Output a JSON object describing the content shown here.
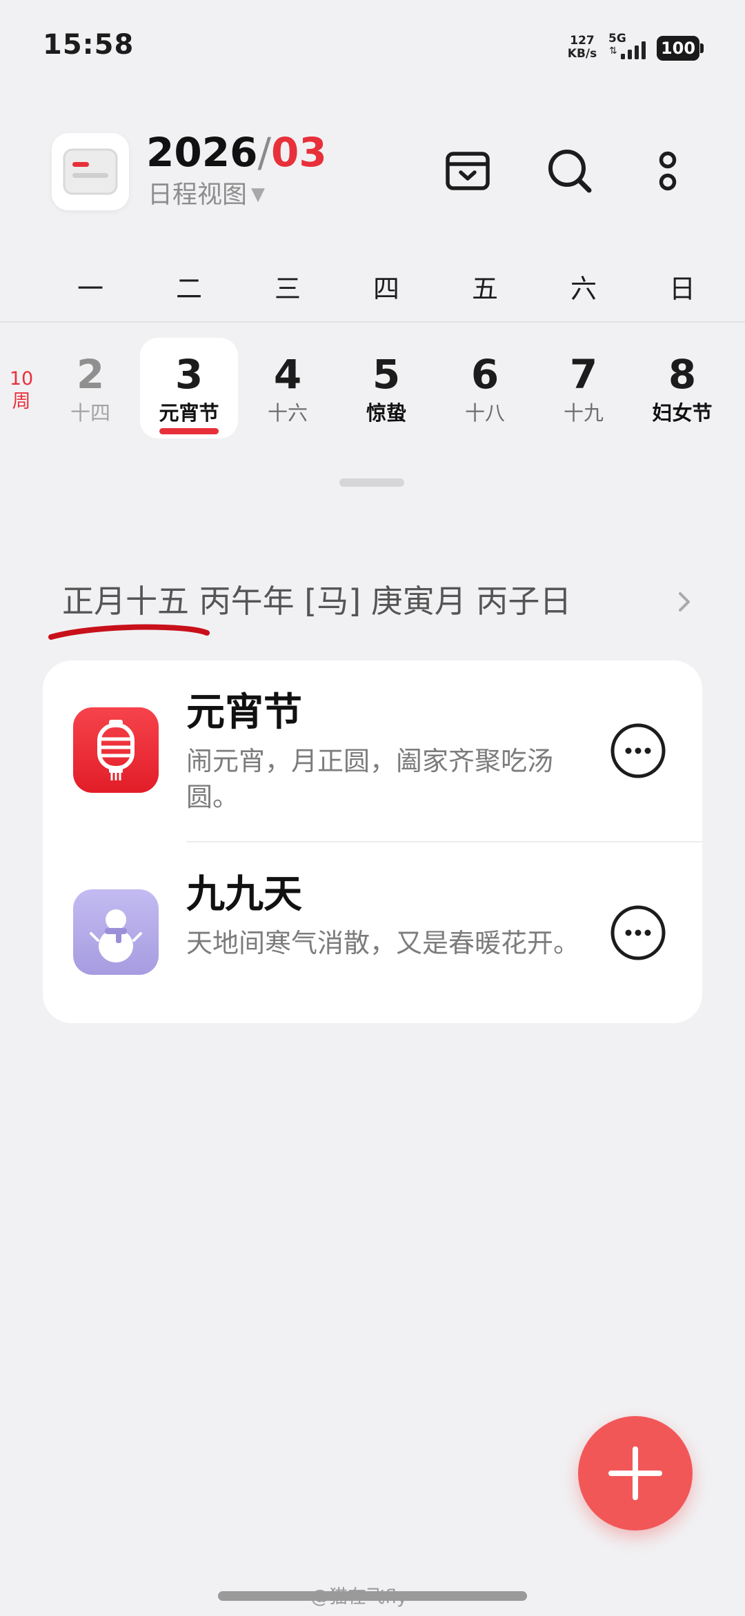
{
  "status_bar": {
    "time": "15:58",
    "net_speed_value": "127",
    "net_speed_unit": "KB/s",
    "network_type": "5G",
    "battery": "100"
  },
  "header": {
    "year": "2026",
    "separator": "/",
    "month": "03",
    "view_mode": "日程视图"
  },
  "weekdays": [
    "一",
    "二",
    "三",
    "四",
    "五",
    "六",
    "日"
  ],
  "week": {
    "number": "10",
    "unit": "周",
    "days": [
      {
        "num": "2",
        "sub": "十四"
      },
      {
        "num": "3",
        "sub": "元宵节"
      },
      {
        "num": "4",
        "sub": "十六"
      },
      {
        "num": "5",
        "sub": "惊蛰"
      },
      {
        "num": "6",
        "sub": "十八"
      },
      {
        "num": "7",
        "sub": "十九"
      },
      {
        "num": "8",
        "sub": "妇女节"
      }
    ]
  },
  "lunar": {
    "lunar_date": "正月十五",
    "ganzhi": "丙午年 [马] 庚寅月 丙子日"
  },
  "events": [
    {
      "title": "元宵节",
      "description": "闹元宵，月正圆，阖家齐聚吃汤圆。",
      "icon": "lantern-icon"
    },
    {
      "title": "九九天",
      "description": "天地间寒气消散，又是春暖花开。",
      "icon": "snowman-icon"
    }
  ],
  "watermark": "@猫在飞fly",
  "colors": {
    "accent_red": "#e8303a",
    "fab": "#f25758",
    "background": "#f1f1f3",
    "card": "#ffffff",
    "event_icon_red": "#ee2a34",
    "event_icon_purple": "#b2a9e6"
  }
}
